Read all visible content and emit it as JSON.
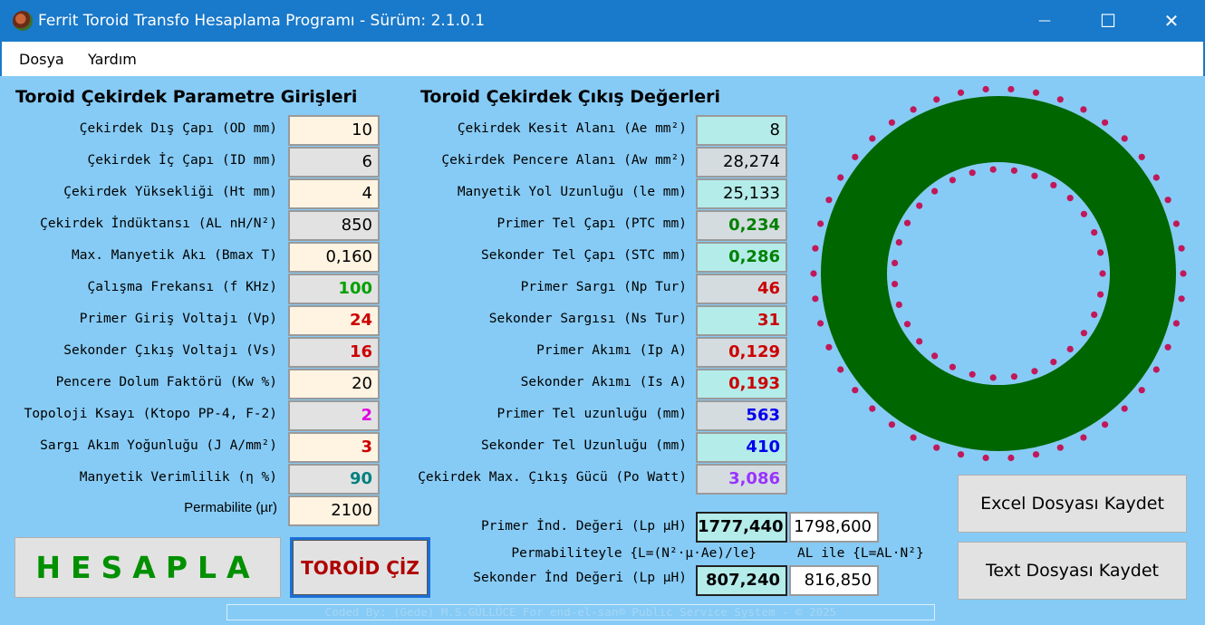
{
  "window": {
    "title": "Ferrit Toroid Transfo Hesaplama Programı - Sürüm: 2.1.0.1",
    "controls": {
      "minimize": "—",
      "maximize": "☐",
      "close": "✕"
    }
  },
  "menu": {
    "items": [
      "Dosya",
      "Yardım"
    ]
  },
  "inputs": {
    "title": "Toroid Çekirdek Parametre Girişleri",
    "rows": [
      {
        "label": "Çekirdek  Dış Çapı (OD mm)",
        "value": "10"
      },
      {
        "label": "Çekirdek İç Çapı (ID mm)",
        "value": "6"
      },
      {
        "label": "Çekirdek Yüksekliği (Ht mm)",
        "value": "4"
      },
      {
        "label": "Çekirdek İndüktansı (AL nH/N²)",
        "value": "850"
      },
      {
        "label": "Max. Manyetik Akı (Bmax T)",
        "value": "0,160"
      },
      {
        "label": "Çalışma Frekansı (f KHz)",
        "value": "100"
      },
      {
        "label": "Primer Giriş Voltajı (Vp)",
        "value": "24"
      },
      {
        "label": "Sekonder Çıkış Voltajı (Vs)",
        "value": "16"
      },
      {
        "label": "Pencere Dolum Faktörü (Kw %)",
        "value": "20"
      },
      {
        "label": "Topoloji Ksayı (Ktopo PP-4, F-2)",
        "value": "2"
      },
      {
        "label": "Sargı Akım Yoğunluğu (J A/mm²)",
        "value": "3"
      },
      {
        "label": "Manyetik Verimlilik (η %)",
        "value": "90"
      },
      {
        "label": "Permabilite (µr)",
        "value": "2100"
      }
    ]
  },
  "outputs": {
    "title": "Toroid Çekirdek Çıkış Değerleri",
    "rows": [
      {
        "label": "Çekirdek Kesit Alanı (Ae mm²)",
        "value": "8"
      },
      {
        "label": "Çekirdek Pencere Alanı (Aw mm²)",
        "value": "28,274"
      },
      {
        "label": "Manyetik Yol Uzunluğu (le mm)",
        "value": "25,133"
      },
      {
        "label": "Primer Tel Çapı (PTC mm)",
        "value": "0,234"
      },
      {
        "label": "Sekonder Tel Çapı (STC mm)",
        "value": "0,286"
      },
      {
        "label": "Primer Sargı (Np Tur)",
        "value": "46"
      },
      {
        "label": "Sekonder Sargısı (Ns Tur)",
        "value": "31"
      },
      {
        "label": "Primer Akımı (Ip A)",
        "value": "0,129"
      },
      {
        "label": "Sekonder Akımı (Is A)",
        "value": "0,193"
      },
      {
        "label": "Primer Tel uzunluğu (mm)",
        "value": "563"
      },
      {
        "label": "Sekonder Tel Uzunluğu (mm)",
        "value": "410"
      },
      {
        "label": "Çekirdek Max. Çıkış Gücü (Po Watt)",
        "value": "3,086"
      }
    ]
  },
  "inductance": {
    "primary_label": "Primer İnd. Değeri (Lp µH)",
    "primary_perm": "1777,440",
    "primary_al": "1798,600",
    "formula_perm": "Permabiliteyle {L=(N²·µ·Ae)/le}",
    "formula_al": "AL ile {L=AL·N²}",
    "secondary_label": "Sekonder İnd Değeri (Lp µH)",
    "secondary_perm": "807,240",
    "secondary_al": "816,850"
  },
  "buttons": {
    "calculate": "HESAPLA",
    "draw": "TOROİD ÇİZ",
    "excel": "Excel Dosyası Kaydet",
    "text": "Text Dosyası Kaydet"
  },
  "toroid": {
    "core_color": "#006600",
    "turn_color": "#c0185a",
    "outer_turns": 46,
    "inner_turns": 31
  },
  "footer": "Coded By: (Gede) M.S.GÜLLÜCE For end-el-san® Public Service System - © 2025",
  "colors": {
    "titlebar": "#1979ca",
    "client_bg": "#86cbf5",
    "green_value": "#00a000",
    "dark_green_value": "#008000",
    "red_value": "#cc0000",
    "magenta_value": "#e000e0",
    "teal_value": "#008080",
    "blue_value": "#0000ee",
    "purple_value": "#9933ff"
  }
}
